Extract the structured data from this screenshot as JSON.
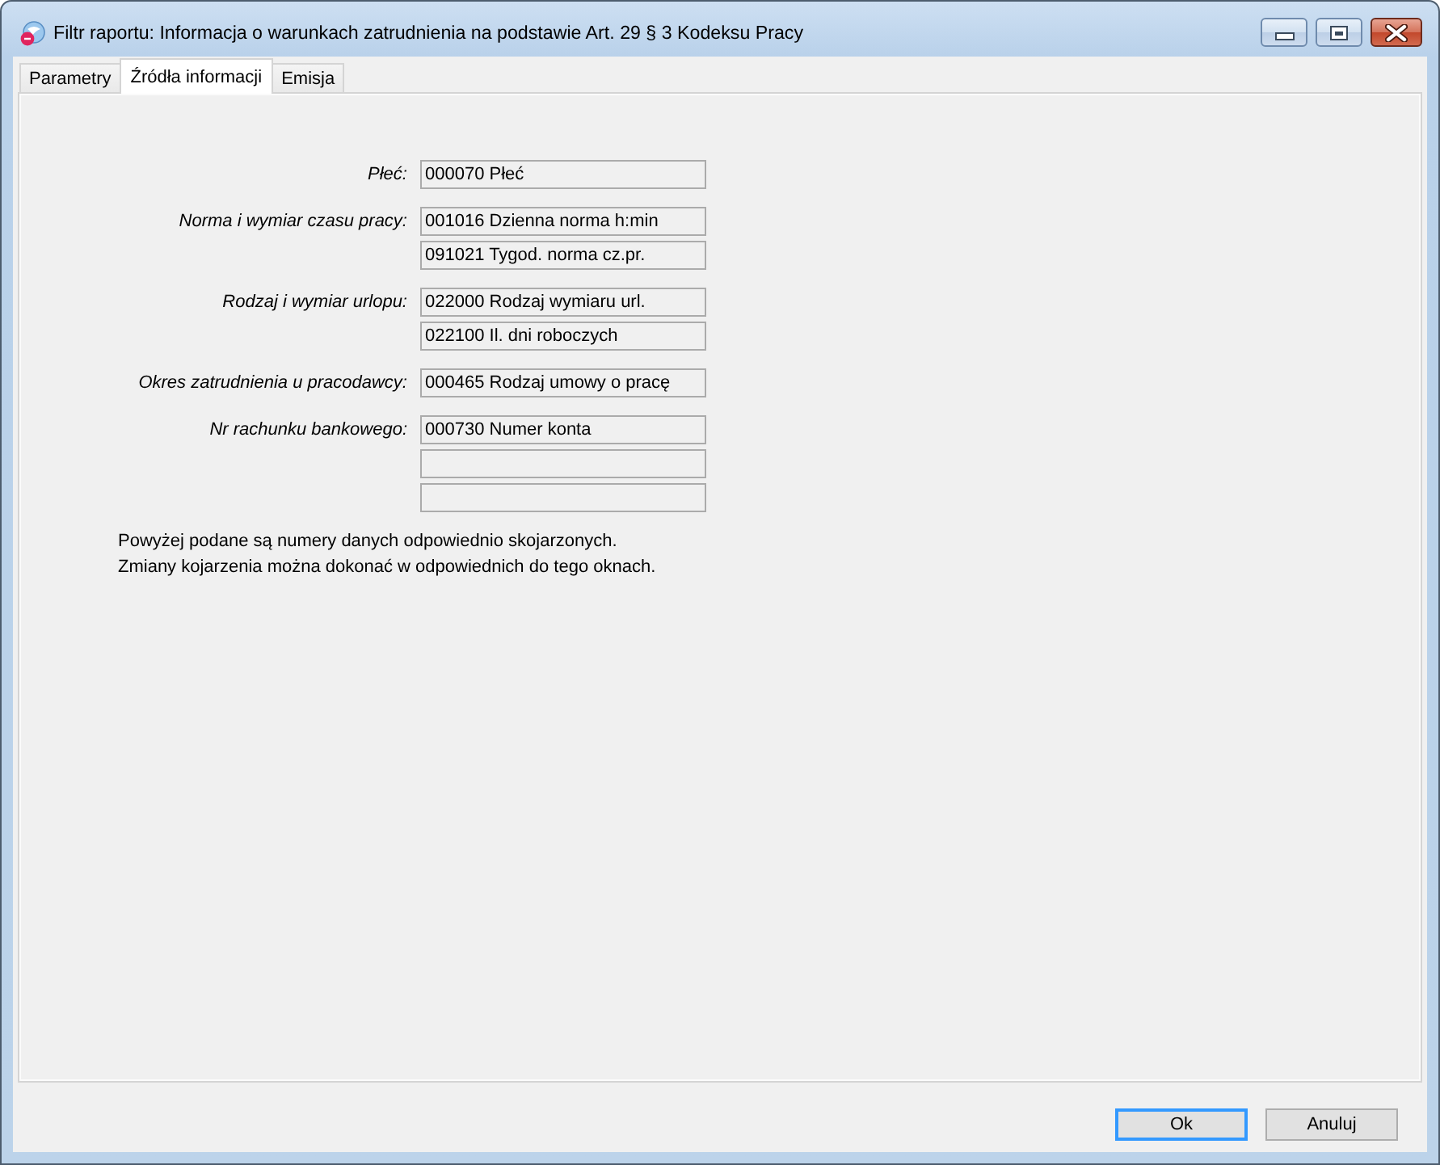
{
  "window": {
    "title": "Filtr raportu: Informacja o warunkach zatrudnienia na podstawie Art. 29 § 3 Kodeksu Pracy"
  },
  "tabs": [
    {
      "label": "Parametry",
      "selected": false
    },
    {
      "label": "Źródła informacji",
      "selected": true
    },
    {
      "label": "Emisja",
      "selected": false
    }
  ],
  "sources": [
    {
      "label": "Płeć:",
      "fields": [
        {
          "kind": "code",
          "value": "000070 Płeć"
        }
      ]
    },
    {
      "label": "Norma i wymiar czasu pracy:",
      "fields": [
        {
          "kind": "code",
          "value": "001016 Dzienna norma h:min"
        },
        {
          "kind": "code",
          "value": "091021 Tygod. norma cz.pr."
        }
      ]
    },
    {
      "label": "Rodzaj i wymiar urlopu:",
      "fields": [
        {
          "kind": "code",
          "value": "022000 Rodzaj wymiaru url."
        },
        {
          "kind": "code",
          "value": "022100 Il. dni roboczych"
        }
      ]
    },
    {
      "label": "Okres zatrudnienia u pracodawcy:",
      "fields": [
        {
          "kind": "code",
          "value": "000465 Rodzaj umowy o pracę"
        }
      ]
    },
    {
      "label": "Nr rachunku bankowego:",
      "fields": [
        {
          "kind": "code",
          "value": "000730 Numer konta"
        },
        {
          "kind": "blank"
        },
        {
          "kind": "blank"
        }
      ]
    }
  ],
  "note": [
    "Powyżej podane są numery danych odpowiednio skojarzonych.",
    "Zmiany kojarzenia można dokonać w odpowiednich do tego oknach."
  ],
  "buttons": [
    {
      "label": "Ok",
      "focused": true
    },
    {
      "label": "Anuluj",
      "focused": false
    }
  ]
}
